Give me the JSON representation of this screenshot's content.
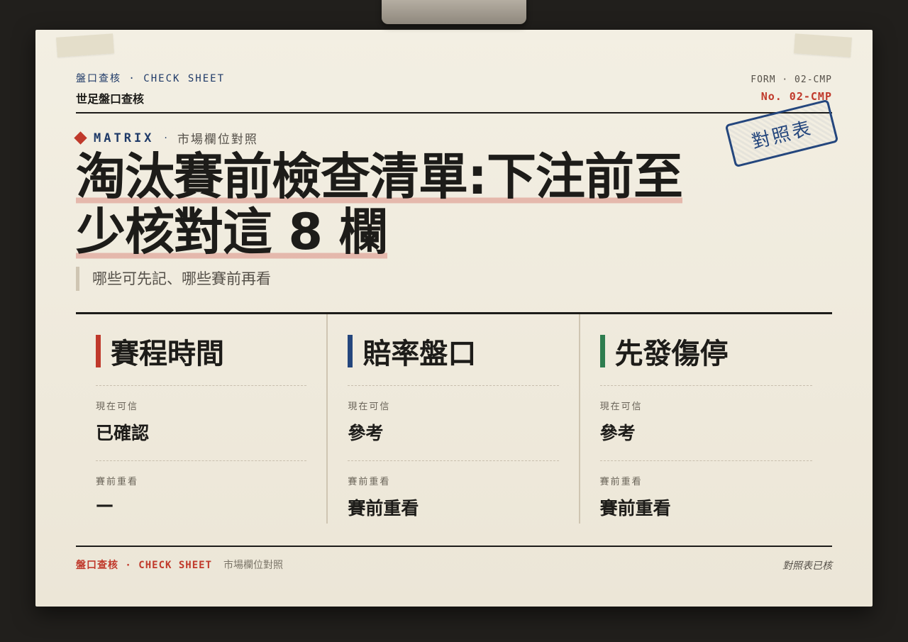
{
  "header": {
    "brand_line": "盤口查核 · CHECK SHEET",
    "brand_sub": "世足盤口查核",
    "form_code": "FORM · 02-CMP",
    "form_no": "No. 02-CMP"
  },
  "stamp": {
    "text": "對照表"
  },
  "kicker": {
    "matrix": "MATRIX",
    "separator": "·",
    "label": "市場欄位對照"
  },
  "headline": {
    "title": "淘汰賽前檢查清單:下注前至少核對這 8 欄",
    "subtitle": "哪些可先記、哪些賽前再看"
  },
  "columns": [
    {
      "name": "賽程時間",
      "accent": "#c0392b",
      "rows": [
        {
          "label": "現在可信",
          "value": "已確認"
        },
        {
          "label": "賽前重看",
          "value": "—"
        }
      ]
    },
    {
      "name": "賠率盤口",
      "accent": "#24467d",
      "rows": [
        {
          "label": "現在可信",
          "value": "參考"
        },
        {
          "label": "賽前重看",
          "value": "賽前重看"
        }
      ]
    },
    {
      "name": "先發傷停",
      "accent": "#2e7d4f",
      "rows": [
        {
          "label": "現在可信",
          "value": "參考"
        },
        {
          "label": "賽前重看",
          "value": "賽前重看"
        }
      ]
    }
  ],
  "footer": {
    "brand": "盤口查核 · CHECK SHEET",
    "label": "市場欄位對照",
    "status": "對照表已核"
  },
  "colors": {
    "accent_red": "#c0392b",
    "accent_blue": "#1f3a68",
    "paper": "#f3efe3",
    "backdrop": "#211f1c"
  }
}
